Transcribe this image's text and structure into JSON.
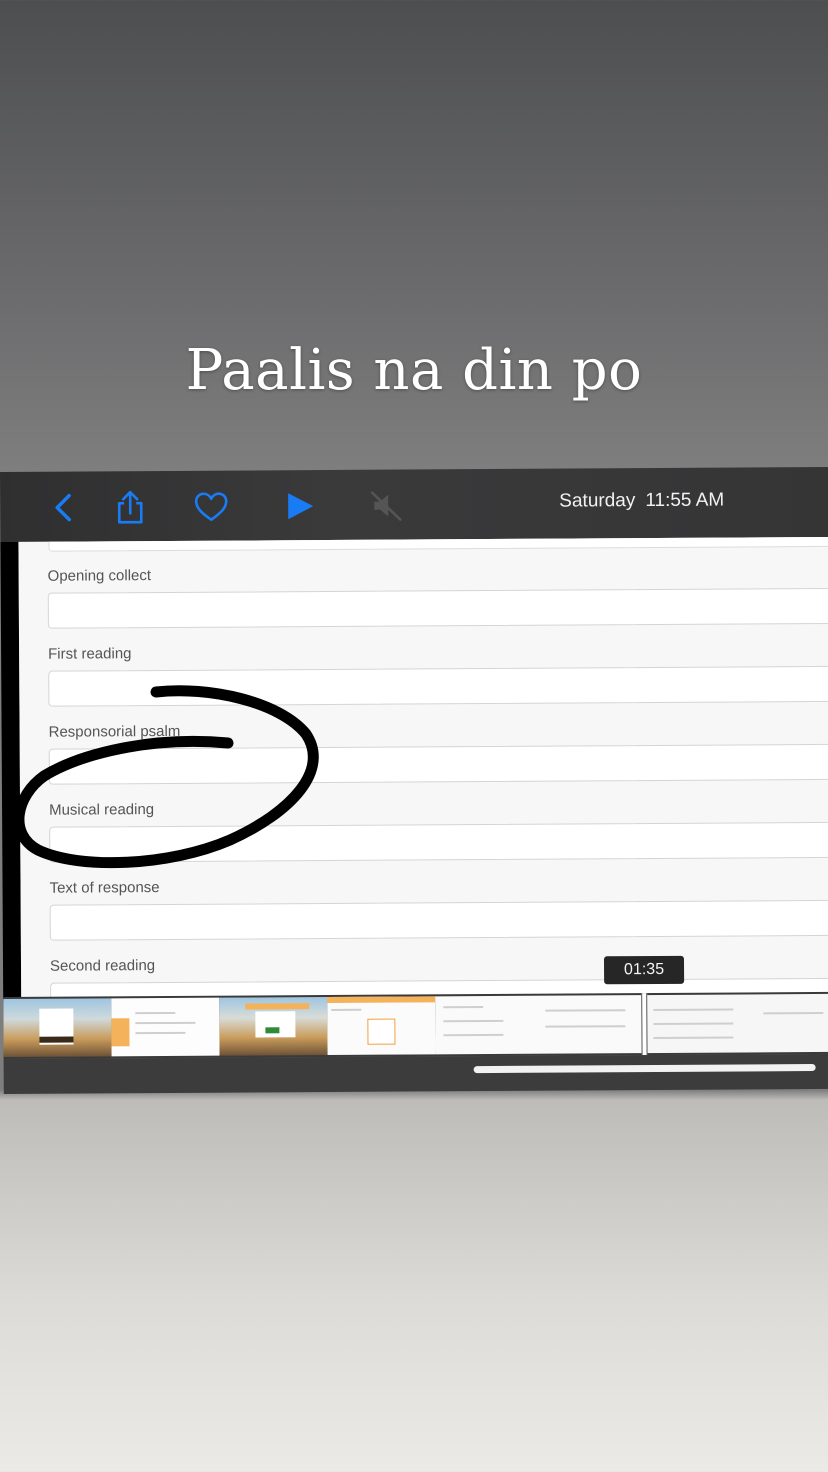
{
  "story": {
    "caption": "Paalis na din po"
  },
  "toolbar": {
    "icons": [
      "back-chevron-icon",
      "share-icon",
      "heart-icon",
      "play-icon",
      "mute-icon"
    ],
    "day": "Saturday",
    "time": "11:55 AM",
    "accent_color": "#1a7cf5"
  },
  "form": {
    "fields": [
      {
        "label": "Opening collect",
        "value": ""
      },
      {
        "label": "First reading",
        "value": ""
      },
      {
        "label": "Responsorial psalm",
        "value": ""
      },
      {
        "label": "Musical reading",
        "value": ""
      },
      {
        "label": "Text of response",
        "value": ""
      },
      {
        "label": "Second reading",
        "value": ""
      }
    ]
  },
  "video": {
    "timestamp": "01:35"
  },
  "annotation": {
    "stroke_color": "#000000"
  }
}
